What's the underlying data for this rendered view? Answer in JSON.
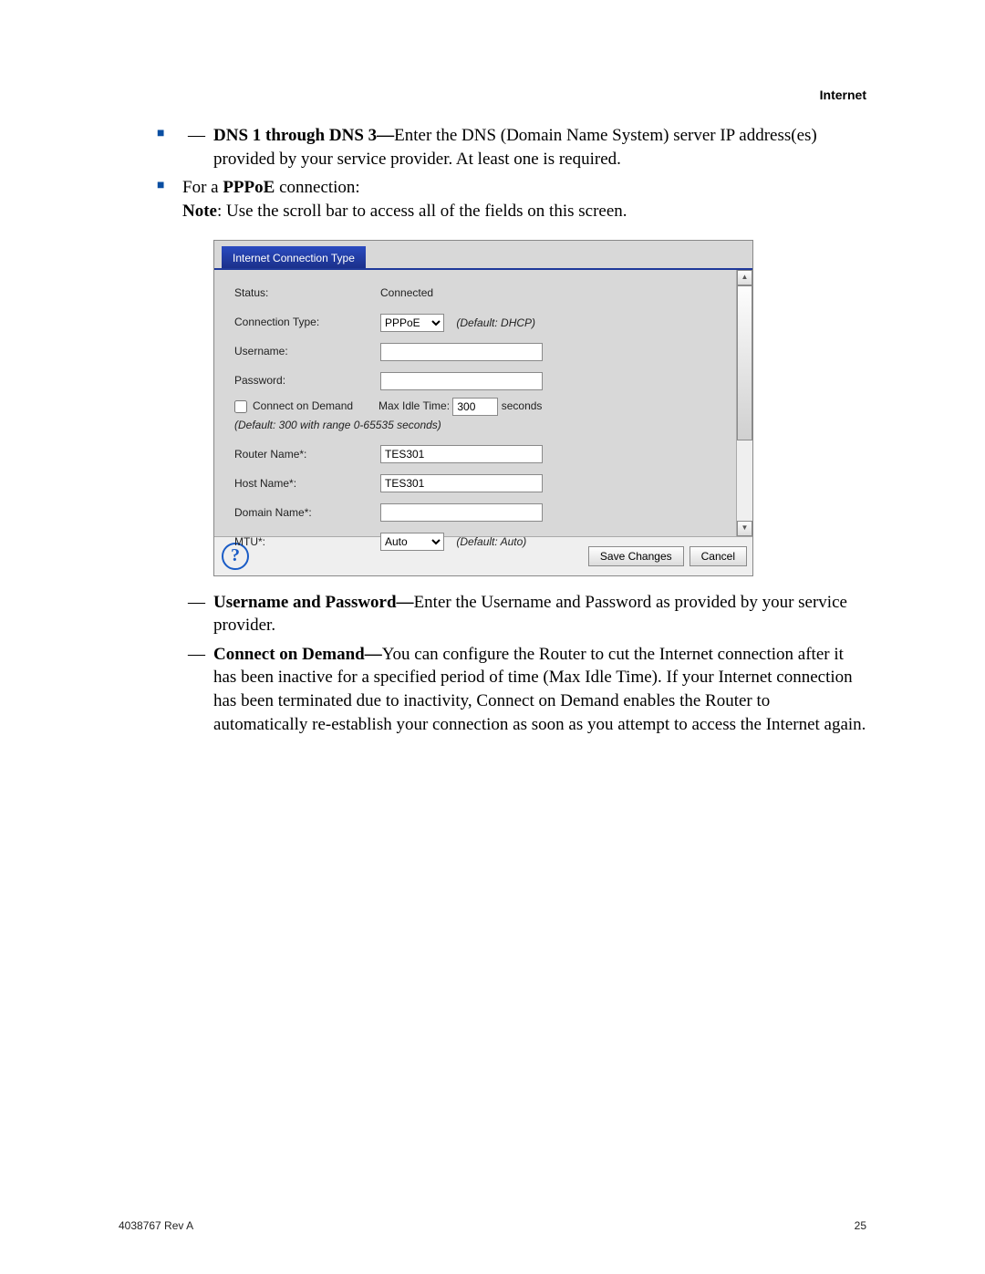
{
  "header": {
    "section": "Internet"
  },
  "doc": {
    "dns_bold": "DNS 1 through DNS 3—",
    "dns_text": "Enter the DNS (Domain Name System) server IP address(es) provided by your service provider. At least one is required.",
    "pppoe_intro_a": "For a ",
    "pppoe_intro_bold": "PPPoE",
    "pppoe_intro_b": " connection:",
    "note_bold": "Note",
    "note_text": ": Use the scroll bar to access all of the fields on this screen.",
    "up_bold": "Username and Password—",
    "up_text": "Enter the Username and Password as provided by your service provider.",
    "cod_bold": "Connect on Demand—",
    "cod_text": "You can configure the Router to cut the Internet connection after it has been inactive for a specified period of time (Max Idle Time). If your Internet connection has been terminated due to inactivity, Connect on Demand enables the Router to automatically re-establish your connection as soon as you attempt to access the Internet again."
  },
  "ui": {
    "tab": "Internet Connection Type",
    "status_label": "Status:",
    "status_value": "Connected",
    "conn_type_label": "Connection Type:",
    "conn_type_value": "PPPoE",
    "conn_type_hint": "(Default: DHCP)",
    "username_label": "Username:",
    "username_value": "",
    "password_label": "Password:",
    "password_value": "",
    "connect_on_demand": "Connect on Demand",
    "max_idle_label": "Max Idle Time:",
    "max_idle_value": "300",
    "seconds": "seconds",
    "default_idle": "(Default: 300 with range 0-65535 seconds)",
    "router_name_label": "Router Name*:",
    "router_name_value": "TES301",
    "host_name_label": "Host Name*:",
    "host_name_value": "TES301",
    "domain_name_label": "Domain Name*:",
    "domain_name_value": "",
    "mtu_label": "MTU*:",
    "mtu_value": "Auto",
    "mtu_hint": "(Default: Auto)",
    "help": "?",
    "save": "Save Changes",
    "cancel": "Cancel"
  },
  "footer": {
    "left": "4038767 Rev A",
    "right": "25"
  }
}
